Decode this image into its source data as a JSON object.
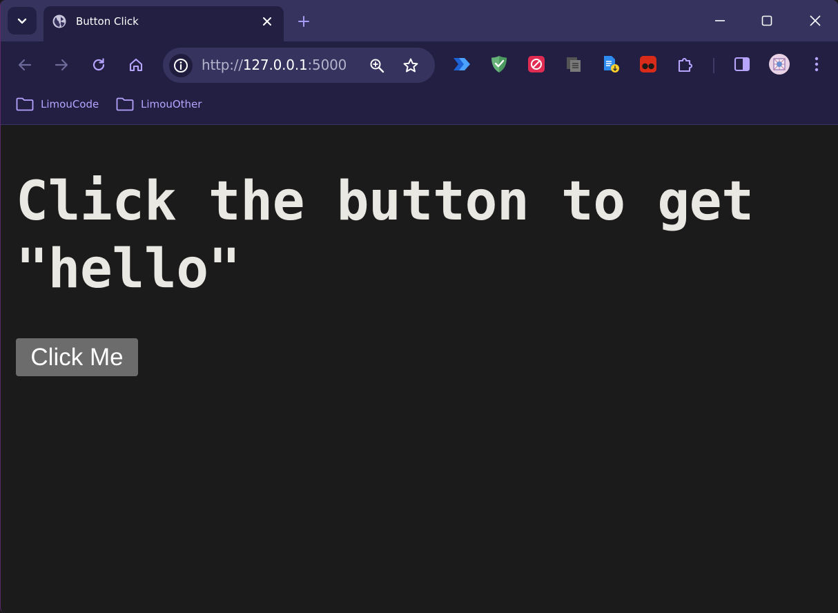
{
  "browser": {
    "tab": {
      "title": "Button Click"
    },
    "url": {
      "scheme": "http://",
      "host": "127.0.0.1",
      "port": ":5000"
    },
    "bookmarks": [
      {
        "label": "LimouCode"
      },
      {
        "label": "LimouOther"
      }
    ],
    "icons": {
      "tab_search": "chevron-down-icon",
      "favicon": "globe-icon",
      "tab_close": "close-icon",
      "new_tab": "plus-icon",
      "minimize": "minimize-icon",
      "maximize": "maximize-icon",
      "window_close": "close-icon",
      "back": "arrow-left-icon",
      "forward": "arrow-right-icon",
      "reload": "reload-icon",
      "home": "home-icon",
      "site_info": "info-icon",
      "zoom": "zoom-icon",
      "bookmark_star": "star-icon",
      "extensions": [
        "power-automate-icon",
        "adguard-shield-icon",
        "adblock-icon",
        "copy-icon",
        "file-download-icon",
        "tampermonkey-icon",
        "puzzle-icon"
      ],
      "side_panel": "side-panel-icon",
      "profile": "avatar-icon",
      "menu": "more-vert-icon",
      "bookmark_folder": "folder-icon"
    },
    "colors": {
      "tabstrip": "#37335f",
      "toolbar": "#221f42",
      "accent": "#b6a4ff"
    }
  },
  "content": {
    "heading": "Click the button to get \"hello\"",
    "button_label": "Click Me"
  }
}
